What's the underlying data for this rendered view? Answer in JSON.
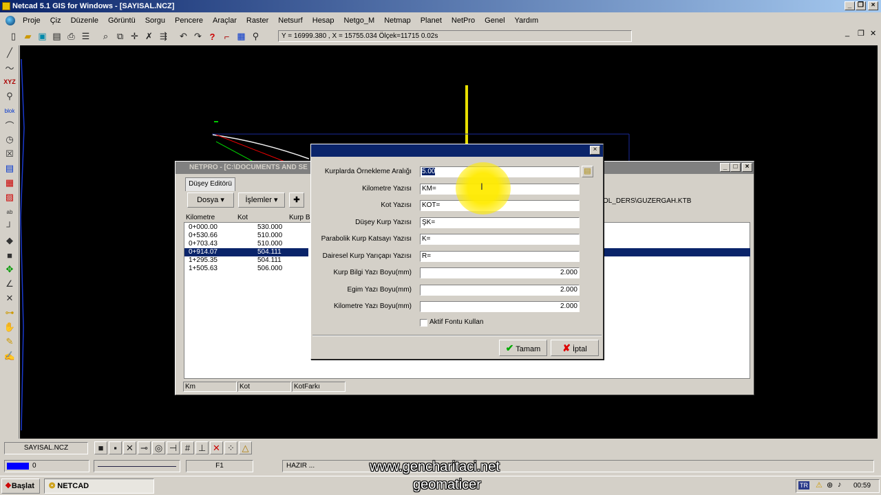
{
  "app": {
    "title": "Netcad 5.1 GIS for Windows - [SAYISAL.NCZ]"
  },
  "menu": [
    "Proje",
    "Çiz",
    "Düzenle",
    "Görüntü",
    "Sorgu",
    "Pencere",
    "Araçlar",
    "Raster",
    "Netsurf",
    "Hesap",
    "Netgo_M",
    "Netmap",
    "Planet",
    "NetPro",
    "Genel",
    "Yardım"
  ],
  "toolbar": {
    "coords": "Y = 16999.380 , X = 15755.034  Ölçek=11715   0.02s"
  },
  "netpro": {
    "title": "NETPRO - [C:\\DOCUMENTS AND SE",
    "tab": "Düşey Editörü",
    "dosya": "Dosya",
    "islemler": "İşlemler",
    "path": "OL_DERS\\GUZERGAH.KTB",
    "columns": [
      "Kilometre",
      "Kot",
      "Kurp B"
    ],
    "rows": [
      {
        "km": "0+000.00",
        "kot": "530.000"
      },
      {
        "km": "0+530.66",
        "kot": "510.000"
      },
      {
        "km": "0+703.43",
        "kot": "510.000"
      },
      {
        "km": "0+914.07",
        "kot": "504.111"
      },
      {
        "km": "1+295.35",
        "kot": "504.111"
      },
      {
        "km": "1+505.63",
        "kot": "506.000"
      }
    ],
    "status": [
      "Km",
      "Kot",
      "KotFarkı"
    ]
  },
  "dialog": {
    "fields": [
      {
        "label": "Kurplarda Örnekleme Aralığı",
        "value": "5.00"
      },
      {
        "label": "Kilometre Yazısı",
        "value": "KM="
      },
      {
        "label": "Kot Yazısı",
        "value": "KOT="
      },
      {
        "label": "Düşey Kurp Yazısı",
        "value": "ŞK="
      },
      {
        "label": "Parabolik Kurp Katsayı Yazısı",
        "value": "K="
      },
      {
        "label": "Dairesel Kurp Yarıçapı Yazısı",
        "value": "R="
      },
      {
        "label": "Kurp Bilgi Yazı Boyu(mm)",
        "value": "2.000"
      },
      {
        "label": "Egim Yazı Boyu(mm)",
        "value": "2.000"
      },
      {
        "label": "Kilometre Yazı Boyu(mm)",
        "value": "2.000"
      }
    ],
    "checkbox": "Aktif Fontu Kullan",
    "ok": "Tamam",
    "cancel": "İptal"
  },
  "statusbar": {
    "file": "SAYISAL.NCZ",
    "layer": "0",
    "fkey": "F1",
    "state": "HAZIR ..."
  },
  "taskbar": {
    "start": "Başlat",
    "app": "NETCAD",
    "lang": "TR",
    "time": "00:59"
  },
  "watermark": {
    "line1": "www.gencharitaci.net",
    "line2": "geomaticer"
  }
}
